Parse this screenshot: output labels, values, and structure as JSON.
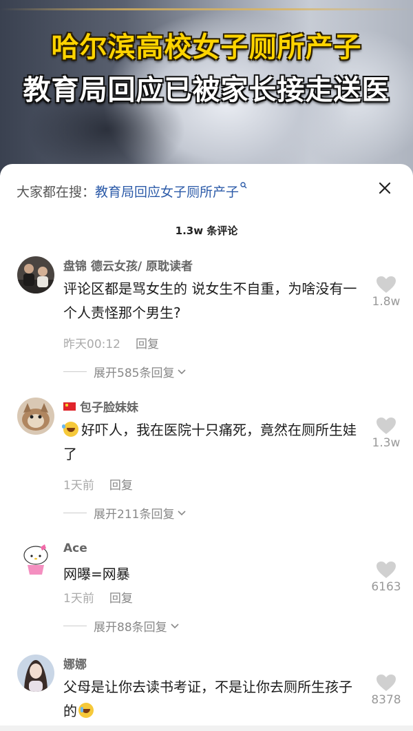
{
  "video": {
    "headline_line1": "哈尔滨高校女子厕所产子",
    "headline_line2": "教育局回应已被家长接走送医"
  },
  "search": {
    "prefix": "大家都在搜：",
    "term": "教育局回应女子厕所产子",
    "icon": "search-icon"
  },
  "close_icon": "close-icon",
  "comments_count": "1.3w 条评论",
  "comments": [
    {
      "username": "盘锦 德云女孩/ 原耽读者",
      "text": "评论区都是骂女生的 说女生不自重，为啥没有一个人责怪那个男生?",
      "time": "昨天00:12",
      "reply": "回复",
      "expand": "展开585条回复",
      "likes": "1.8w"
    },
    {
      "username": "包子脸妹妹",
      "flag": "china-flag",
      "emoji": "laughing-crying-emoji",
      "text": "好吓人，我在医院十只痛死，竟然在厕所生娃了",
      "time": "1天前",
      "reply": "回复",
      "expand": "展开211条回复",
      "likes": "1.3w"
    },
    {
      "username": "Ace",
      "text": "网曝=网暴",
      "time": "1天前",
      "reply": "回复",
      "expand": "展开88条回复",
      "likes": "6163"
    },
    {
      "username": "娜娜",
      "text": "父母是让你去读书考证，不是让你去厕所生孩子的",
      "emoji": "crying-emoji",
      "likes": "8378"
    }
  ],
  "colors": {
    "headline_yellow": "#ffd400",
    "search_link": "#2b5aa8",
    "meta_gray": "#aaaaaa"
  }
}
